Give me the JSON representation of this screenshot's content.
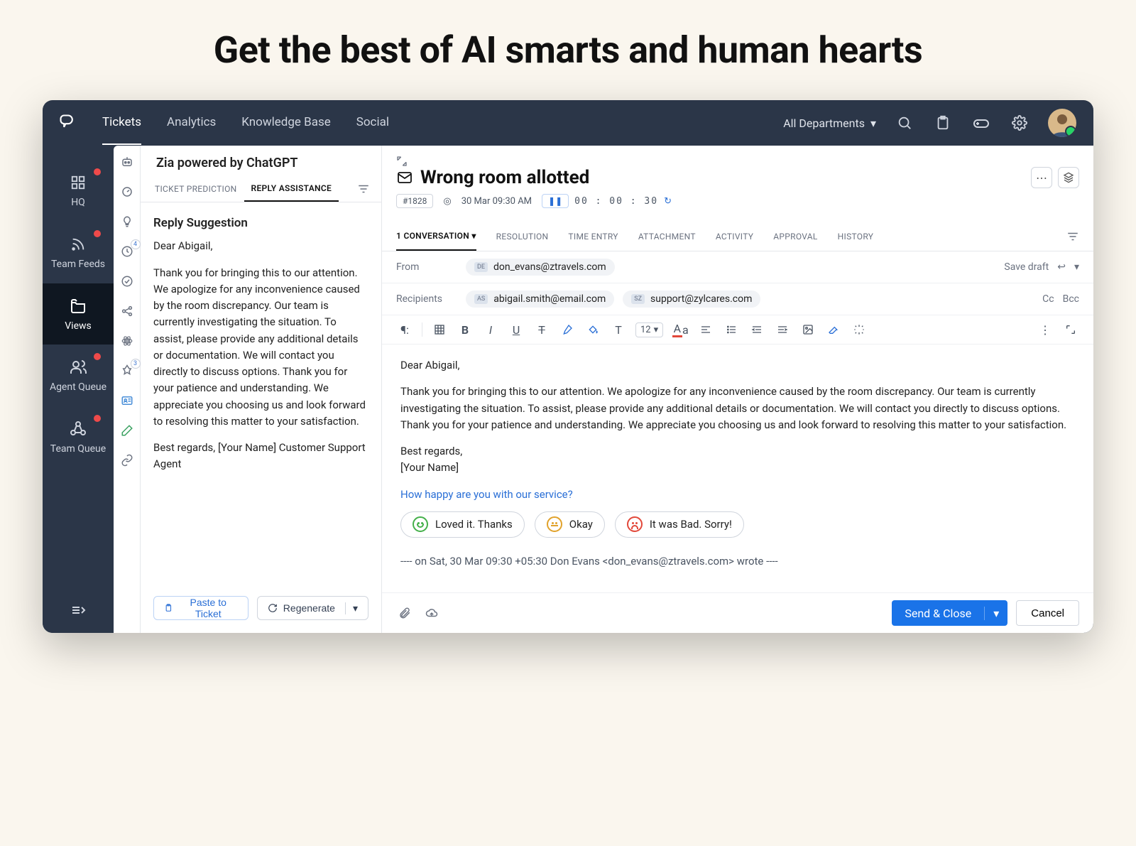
{
  "headline": "Get the best of AI smarts and human hearts",
  "topnav": {
    "items": [
      "Tickets",
      "Analytics",
      "Knowledge Base",
      "Social"
    ],
    "active": 0
  },
  "department_selector": "All Departments",
  "leftnav": {
    "items": [
      {
        "label": "HQ",
        "icon": "grid"
      },
      {
        "label": "Team Feeds",
        "icon": "rss"
      },
      {
        "label": "Views",
        "icon": "folder"
      },
      {
        "label": "Agent Queue",
        "icon": "people"
      },
      {
        "label": "Team Queue",
        "icon": "pods"
      }
    ],
    "active": 2
  },
  "zia": {
    "title": "Zia powered by ChatGPT",
    "tabs": [
      "TICKET PREDICTION",
      "REPLY ASSISTANCE"
    ],
    "active_tab": 1,
    "subtitle": "Reply Suggestion",
    "greeting": "Dear Abigail,",
    "body": "Thank you for bringing this to our attention. We apologize for any inconvenience caused by the room discrepancy. Our team is currently investigating the situation. To assist, please provide any additional details or documentation. We will contact you directly to discuss options. Thank you for your patience and understanding. We appreciate you choosing us and look forward to resolving this matter to your satisfaction.",
    "signoff": "Best regards, [Your Name] Customer Support Agent",
    "paste_label": "Paste to Ticket",
    "regen_label": "Regenerate"
  },
  "ticket": {
    "title": "Wrong room allotted",
    "id": "#1828",
    "datetime": "30 Mar 09:30 AM",
    "timer": "00 : 00 : 30",
    "tabs": [
      "1 CONVERSATION",
      "RESOLUTION",
      "TIME ENTRY",
      "ATTACHMENT",
      "ACTIVITY",
      "APPROVAL",
      "HISTORY"
    ],
    "active_tab": 0
  },
  "compose": {
    "from_label": "From",
    "from": {
      "tag": "DE",
      "email": "don_evans@ztravels.com"
    },
    "recipients_label": "Recipients",
    "recipients": [
      {
        "tag": "AS",
        "email": "abigail.smith@email.com"
      },
      {
        "tag": "SZ",
        "email": "support@zylcares.com"
      }
    ],
    "save_draft": "Save draft",
    "cc": "Cc",
    "bcc": "Bcc",
    "font_size": "12",
    "body_greeting": "Dear Abigail,",
    "body_para": "Thank you for bringing this to our attention. We apologize for any inconvenience caused by the room discrepancy. Our team is currently investigating the situation. To assist, please provide any additional details or documentation. We will contact you directly to discuss options. Thank you for your patience and understanding. We appreciate you choosing us and look forward to resolving this matter to your satisfaction.",
    "body_regards": "Best regards,",
    "body_name": "[Your Name]",
    "csat_question": "How happy are you with our service?",
    "csat_options": [
      "Loved it. Thanks",
      "Okay",
      "It was Bad. Sorry!"
    ],
    "quoted_header": "---- on Sat, 30 Mar 09:30 +05:30 Don Evans <don_evans@ztravels.com> wrote ----",
    "send_label": "Send & Close",
    "cancel_label": "Cancel"
  },
  "colors": {
    "primary": "#1a73e8",
    "shell": "#2b3648",
    "danger_dot": "#ef4a4a"
  }
}
